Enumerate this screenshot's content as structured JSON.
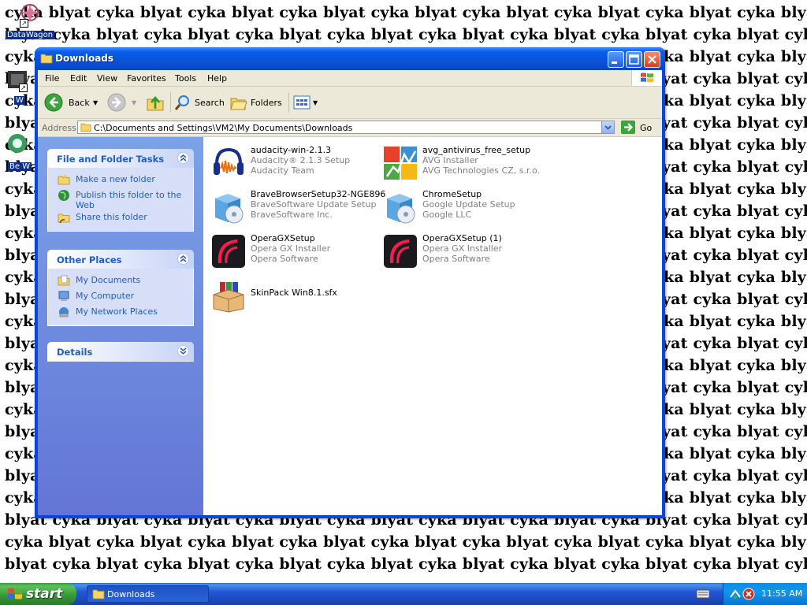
{
  "desktop": {
    "wallpaper_phrase": "cyka blyat cyka blyat cyka blyat cyka blyat cyka blyat cyka blyat cyka blyat cyka blyat cyka blyat cyka blyat",
    "wallpaper_phrase_alt": "blyat cyka blyat cyka blyat cyka blyat cyka blyat cyka blyat cyka blyat cyka blyat cyka blyat cyka blyat cyka",
    "icons": [
      {
        "label": "DataWagon",
        "icon": "datawagon-icon"
      },
      {
        "label": "W",
        "icon": "app-icon"
      },
      {
        "label": "Be W",
        "icon": "app-icon"
      }
    ]
  },
  "window": {
    "title": "Downloads",
    "menu": [
      "File",
      "Edit",
      "View",
      "Favorites",
      "Tools",
      "Help"
    ],
    "toolbar": {
      "back_label": "Back",
      "search_label": "Search",
      "folders_label": "Folders"
    },
    "address": {
      "label": "Address",
      "value": "C:\\Documents and Settings\\VM2\\My Documents\\Downloads",
      "go_label": "Go"
    },
    "side_panel": {
      "file_tasks": {
        "title": "File and Folder Tasks",
        "items": [
          "Make a new folder",
          "Publish this folder to the Web",
          "Share this folder"
        ]
      },
      "other_places": {
        "title": "Other Places",
        "items": [
          "My Documents",
          "My Computer",
          "My Network Places"
        ]
      },
      "details": {
        "title": "Details"
      }
    },
    "files": [
      {
        "name": "audacity-win-2.1.3",
        "desc": "Audacity® 2.1.3 Setup",
        "company": "Audacity Team",
        "icon": "audacity-icon"
      },
      {
        "name": "avg_antivirus_free_setup",
        "desc": "AVG Installer",
        "company": "AVG Technologies CZ, s.r.o.",
        "icon": "avg-icon"
      },
      {
        "name": "BraveBrowserSetup32-NGE896",
        "desc": "BraveSoftware Update Setup",
        "company": "BraveSoftware Inc.",
        "icon": "installer-icon"
      },
      {
        "name": "ChromeSetup",
        "desc": "Google Update Setup",
        "company": "Google LLC",
        "icon": "installer-icon"
      },
      {
        "name": "OperaGXSetup",
        "desc": "Opera GX Installer",
        "company": "Opera Software",
        "icon": "opera-gx-icon"
      },
      {
        "name": "OperaGXSetup (1)",
        "desc": "Opera GX Installer",
        "company": "Opera Software",
        "icon": "opera-gx-icon"
      },
      {
        "name": "SkinPack Win8.1.sfx",
        "desc": "",
        "company": "",
        "icon": "archive-icon"
      }
    ]
  },
  "taskbar": {
    "start_label": "start",
    "task_button_label": "Downloads",
    "clock": "11:55 AM"
  }
}
